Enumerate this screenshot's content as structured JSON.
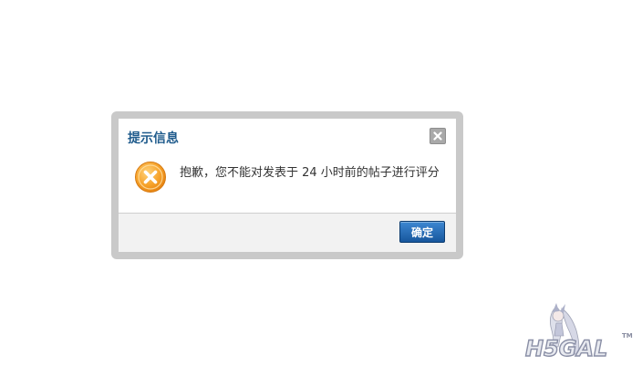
{
  "dialog": {
    "title": "提示信息",
    "message": "抱歉，您不能对发表于 24 小时前的帖子进行评分",
    "ok_label": "确定",
    "close_icon": "close-icon",
    "status_icon": "error-icon"
  },
  "watermark": {
    "logo_text": "H5GAL",
    "trademark": "TM"
  },
  "colors": {
    "title": "#1f5b8c",
    "button": "#1f62aa",
    "error_icon": "#f39b1e",
    "frame": "#c9c9c9"
  }
}
